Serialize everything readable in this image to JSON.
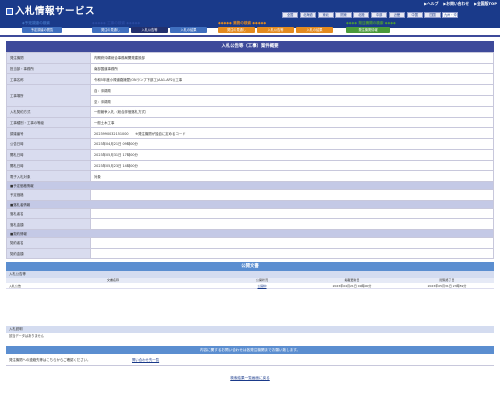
{
  "app": {
    "title": "入札情報サービス"
  },
  "toplinks": {
    "help": "▶ヘルプ",
    "contact": "▶お問い合わせ",
    "top": "▶全国版TOP"
  },
  "regions": [
    "全国",
    "北海道",
    "東北",
    "関東",
    "北陸",
    "中部",
    "近畿",
    "中国",
    "四国",
    "九州・沖縄"
  ],
  "categories": {
    "plan": "◆予定調達の検索",
    "construction": "工事の検索",
    "consultant": "業務の検索",
    "orderer": "発注機関の検索"
  },
  "nav_tabs": {
    "plan_announce": "予定調達の閲覧",
    "construction_plan": "発注の見通し",
    "construction_notice": "入札公告等",
    "construction_result": "入札の結果",
    "consult_plan": "発注の見通し",
    "consult_notice": "入札公告等",
    "consult_result": "入札の結果",
    "orderer_info": "発注機関情報"
  },
  "form": {
    "title": "入札公告等（工事）案件概要",
    "rows": [
      {
        "label": "発注機関",
        "value": "内閣府沖縄総合事務局開発建設部"
      },
      {
        "label": "担当部・事務所",
        "value": "南部国道事務所"
      },
      {
        "label": "工事名称",
        "value": "令和5年度小禄道路擁壁(ONランプ下部工(AA1-AP2))工事"
      },
      {
        "label": "工事場所",
        "value": "自：沖縄県",
        "value2": "至：沖縄県"
      },
      {
        "label": "入札契約方式",
        "value": "一般競争入札（総合評価落札方式）"
      },
      {
        "label": "工事種別・工事の等級",
        "value": "一般土木工事"
      },
      {
        "label": "調達番号",
        "value": "2023990032151000　　※発注機関が独自に定めるコード"
      },
      {
        "label": "公告日時",
        "value": "2023年04月21日 09時00分"
      },
      {
        "label": "開札日時",
        "value": "2023年05月31日 17時00分"
      },
      {
        "label": "開札日時",
        "value": "2023年05月23日 14時00分"
      },
      {
        "label": "電子入札対象",
        "value": "対象"
      }
    ],
    "section_plan": "■予定価格情報",
    "plan_label": "予定価格",
    "section_winner": "■落札者情報",
    "winner_name_label": "落札者名",
    "winner_amount_label": "落札金額",
    "section_contract": "■契約情報",
    "contract_party_label": "契約者名",
    "contract_amount_label": "契約金額"
  },
  "documents": {
    "title": "公開文書",
    "subtitle": "入札公告等",
    "headers": [
      "文書名称",
      "公開状況",
      "掲載更新日",
      "閲覧終了日"
    ],
    "rows": [
      {
        "name": "入札公告",
        "status": "公開中",
        "updated": "2023年04月21日 09時00分",
        "end": "2023年05月31日 23時59分"
      }
    ]
  },
  "notes": {
    "title": "入札説明",
    "body": "該当データはありません"
  },
  "contact": {
    "title": "内容に関するお問い合わせは各発注機関までお願い致します。",
    "label": "発注機関への連絡先等はこちらからご確認ください。",
    "link": "問い合わせ先一覧"
  },
  "back_link": "検索結果一覧画面に戻る",
  "colors": {
    "primary": "#1a3a8a",
    "nav_dark": "#3e4a9a",
    "tab_blue": "#3f6fbf",
    "tab_orange": "#e38a1f",
    "tab_green": "#4a9a3a",
    "tab_active": "#22306e"
  }
}
